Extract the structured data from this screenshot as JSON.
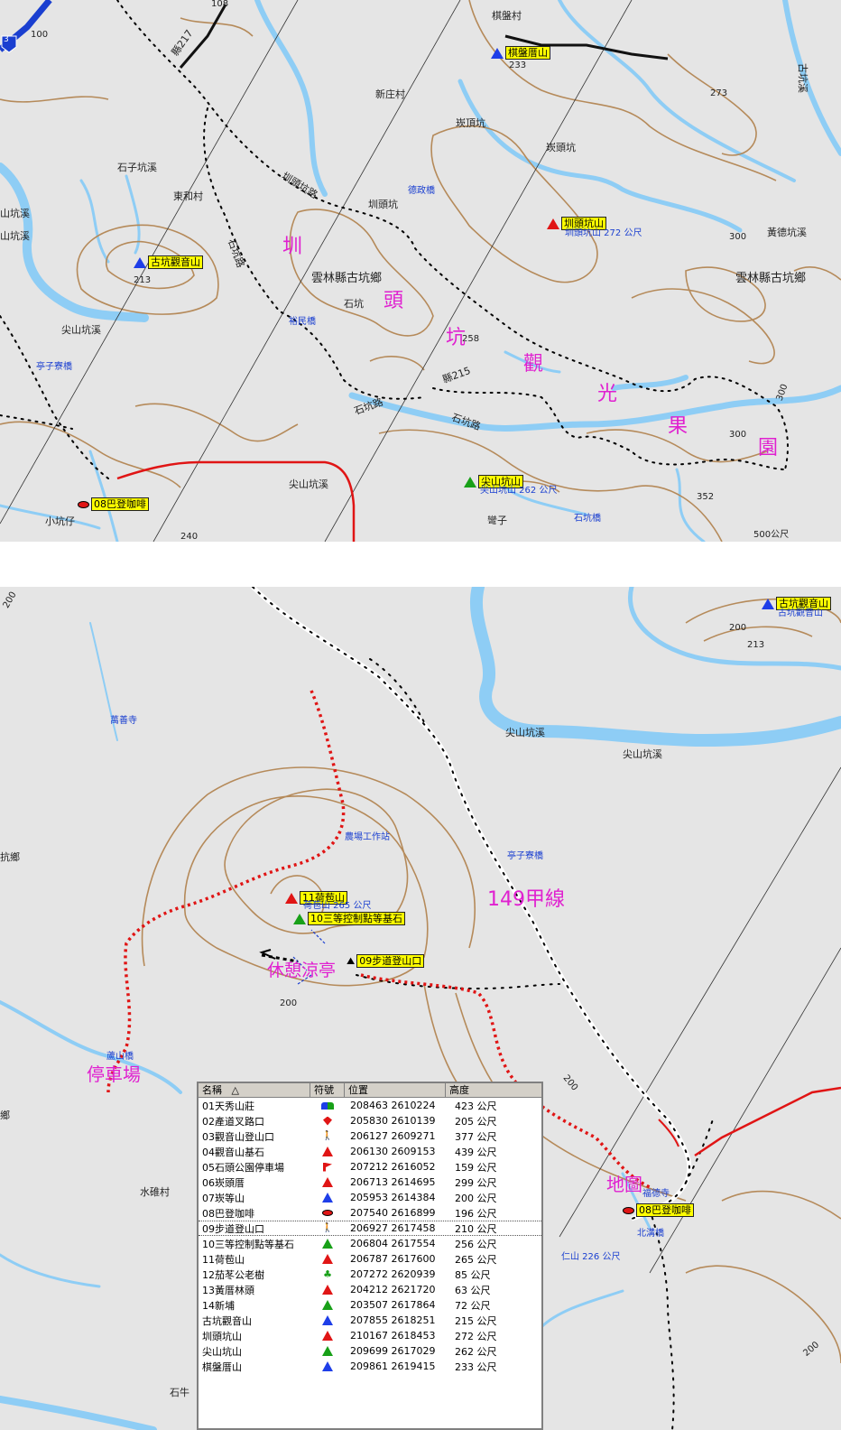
{
  "top_map": {
    "roads": [
      "縣217",
      "圳頭坑路",
      "石坑路",
      "縣215",
      "石坑路",
      "石坑路"
    ],
    "villages": [
      "新庄村",
      "棋盤村",
      "崁頂坑",
      "崁頭坑",
      "石子坑溪",
      "東和村",
      "圳頭坑",
      "雲林縣古坑鄉",
      "石坑",
      "黃德坑溪",
      "雲林縣古坑鄉",
      "尖山坑溪",
      "尖山坑溪",
      "小坑仔",
      "彎子"
    ],
    "edge_labels": [
      "山坑溪",
      "山坑溪",
      "古坑溪"
    ],
    "bridges": [
      "德政橋",
      "裕民橋",
      "亭子寮橋",
      "石坑橋"
    ],
    "numbers": [
      "100",
      "108",
      "273",
      "300",
      "213",
      "258",
      "300",
      "300",
      "352",
      "500公尺",
      "240"
    ],
    "highway_shield": "3",
    "route_banner": [
      "圳",
      "頭",
      "坑",
      "觀",
      "光",
      "果",
      "園"
    ],
    "waypoints": {
      "qipan": {
        "label": "棋盤厝山",
        "sub": "233"
      },
      "guanyin": {
        "label": "古坑觀音山",
        "sub": "213"
      },
      "zhentou": {
        "label": "圳頭坑山",
        "sub": "圳頭坑山 272 公尺"
      },
      "jianshan": {
        "label": "尖山坑山",
        "sub": "尖山坑山 262 公尺"
      },
      "cafe": {
        "label": "08巴登咖啡",
        "sub": ""
      }
    }
  },
  "bottom_map": {
    "labels": [
      "尖山坑溪",
      "尖山坑溪",
      "水碓村",
      "石牛",
      "抗鄉",
      "鄉"
    ],
    "blue_labels": [
      "萬善寺",
      "亭子寮橋",
      "農場工作站",
      "蘆山橋",
      "仁山 226 公尺",
      "北溝橋",
      "福德寺"
    ],
    "numbers": [
      "200",
      "213",
      "200",
      "200",
      "200",
      "200"
    ],
    "pink_labels": [
      "149甲線",
      "休憩涼亭",
      "停車場",
      "地圖"
    ],
    "waypoints": {
      "guanyin": {
        "label": "古坑觀音山",
        "sub": "古坑觀音山"
      },
      "heba": {
        "label": "11荷苞山",
        "sub": "荷苞山 265 公尺"
      },
      "third": {
        "label": "10三等控制點等基石",
        "sub": ""
      },
      "trail": {
        "label": "09步道登山口",
        "sub": ""
      },
      "cafe": {
        "label": "08巴登咖啡",
        "sub": ""
      }
    }
  },
  "waypoint_table": {
    "headers": {
      "name": "名稱",
      "sym": "符號",
      "pos": "位置",
      "alt": "高度"
    },
    "sort_indicator": "△",
    "rows": [
      {
        "name": "01天秀山莊",
        "sym": "house",
        "pos": "208463 2610224",
        "alt": "423 公尺"
      },
      {
        "name": "02產道叉路口",
        "sym": "diamond",
        "pos": "205830 2610139",
        "alt": "205 公尺"
      },
      {
        "name": "03觀音山登山口",
        "sym": "hiker",
        "pos": "206127 2609271",
        "alt": "377 公尺"
      },
      {
        "name": "04觀音山基石",
        "sym": "tri-red",
        "pos": "206130 2609153",
        "alt": "439 公尺"
      },
      {
        "name": "05石頭公園停車場",
        "sym": "flag",
        "pos": "207212 2616052",
        "alt": "159 公尺"
      },
      {
        "name": "06崁頭厝",
        "sym": "tri-red",
        "pos": "206713 2614695",
        "alt": "299 公尺"
      },
      {
        "name": "07崁等山",
        "sym": "tri-blue",
        "pos": "205953 2614384",
        "alt": "200 公尺"
      },
      {
        "name": "08巴登咖啡",
        "sym": "oval",
        "pos": "207540 2616899",
        "alt": "196 公尺"
      },
      {
        "name": "09步道登山口",
        "sym": "hiker",
        "pos": "206927 2617458",
        "alt": "210 公尺"
      },
      {
        "name": "10三等控制點等基石",
        "sym": "tri-green",
        "pos": "206804 2617554",
        "alt": "256 公尺"
      },
      {
        "name": "11荷苞山",
        "sym": "tri-red",
        "pos": "206787 2617600",
        "alt": "265 公尺"
      },
      {
        "name": "12茄苳公老樹",
        "sym": "tree",
        "pos": "207272 2620939",
        "alt": "85 公尺"
      },
      {
        "name": "13黃厝林頭",
        "sym": "tri-red",
        "pos": "204212 2621720",
        "alt": "63 公尺"
      },
      {
        "name": "14新埔",
        "sym": "tri-green",
        "pos": "203507 2617864",
        "alt": "72 公尺"
      },
      {
        "name": "古坑觀音山",
        "sym": "tri-blue",
        "pos": "207855 2618251",
        "alt": "215 公尺"
      },
      {
        "name": "圳頭坑山",
        "sym": "tri-red",
        "pos": "210167 2618453",
        "alt": "272 公尺"
      },
      {
        "name": "尖山坑山",
        "sym": "tri-green",
        "pos": "209699 2617029",
        "alt": "262 公尺"
      },
      {
        "name": "棋盤厝山",
        "sym": "tri-blue",
        "pos": "209861 2619415",
        "alt": "233 公尺"
      }
    ],
    "selected_row": 8
  },
  "colors": {
    "map_bg": "#e5e5e5",
    "river": "#8ecdf5",
    "contour": "#b58a5a",
    "track": "#e01515",
    "label_pink": "#e020d0",
    "waypoint_tag": "#ffff00"
  }
}
